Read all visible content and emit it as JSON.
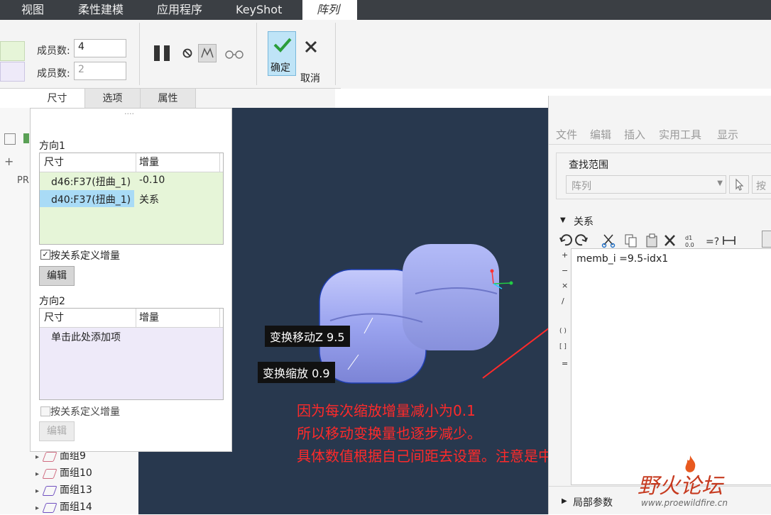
{
  "tabs": [
    {
      "label": "视图"
    },
    {
      "label": "柔性建模"
    },
    {
      "label": "应用程序"
    },
    {
      "label": "KeyShot"
    },
    {
      "label": "阵列"
    }
  ],
  "ribbon": {
    "members_label_1": "成员数:",
    "members_value_1": "4",
    "members_label_2": "成员数:",
    "members_value_2": "2",
    "ok_label": "确定",
    "cancel_label": "取消"
  },
  "subtabs": [
    {
      "label": "尺寸"
    },
    {
      "label": "选项"
    },
    {
      "label": "属性"
    }
  ],
  "panel": {
    "handle": "....",
    "direction1": "方向1",
    "col_dim": "尺寸",
    "col_inc": "增量",
    "rows": [
      {
        "dim": "d46:F37(扭曲_1)",
        "inc": "-0.10"
      },
      {
        "dim": "d40:F37(扭曲_1)",
        "inc": "关系"
      }
    ],
    "by_relation_1": "按关系定义增量",
    "edit_1": "编辑",
    "direction2": "方向2",
    "col_dim_2": "尺寸",
    "col_inc_2": "增量",
    "add_item": "单击此处添加项",
    "by_relation_2": "按关系定义增量",
    "edit_2": "编辑"
  },
  "tree": {
    "items": [
      "面组9",
      "面组10",
      "面组13",
      "面组14"
    ],
    "fragment": "PR"
  },
  "viewport": {
    "label_move": "变换移动Z 9.5",
    "label_scale": "变换缩放 0.9",
    "note_lines": [
      "因为每次缩放增量减小为0.1",
      "所以移动变换量也逐步减少。",
      "具体数值根据自己间距去设置。注意是中心缩小哦。"
    ]
  },
  "relations": {
    "menu": [
      "文件",
      "编辑",
      "插入",
      "实用工具",
      "显示"
    ],
    "search_scope": "查找范围",
    "scope_value": "阵列",
    "scope_btn": "按",
    "section": "关系",
    "operators": [
      "+",
      "−",
      "×",
      "/",
      "( )",
      "[ ]",
      "="
    ],
    "editor_text": "memb_i =9.5-idx1",
    "local_params": "局部参数"
  },
  "watermark": {
    "title": "野火论坛",
    "url": "www.proewildfire.cn"
  },
  "colors": {
    "accent_green": "#e6f5d8",
    "accent_lavender": "#eeeaf9",
    "selected_blue": "#a9dbf6",
    "viewport_bg": "#28384e",
    "note_red": "#ff2a2a"
  }
}
